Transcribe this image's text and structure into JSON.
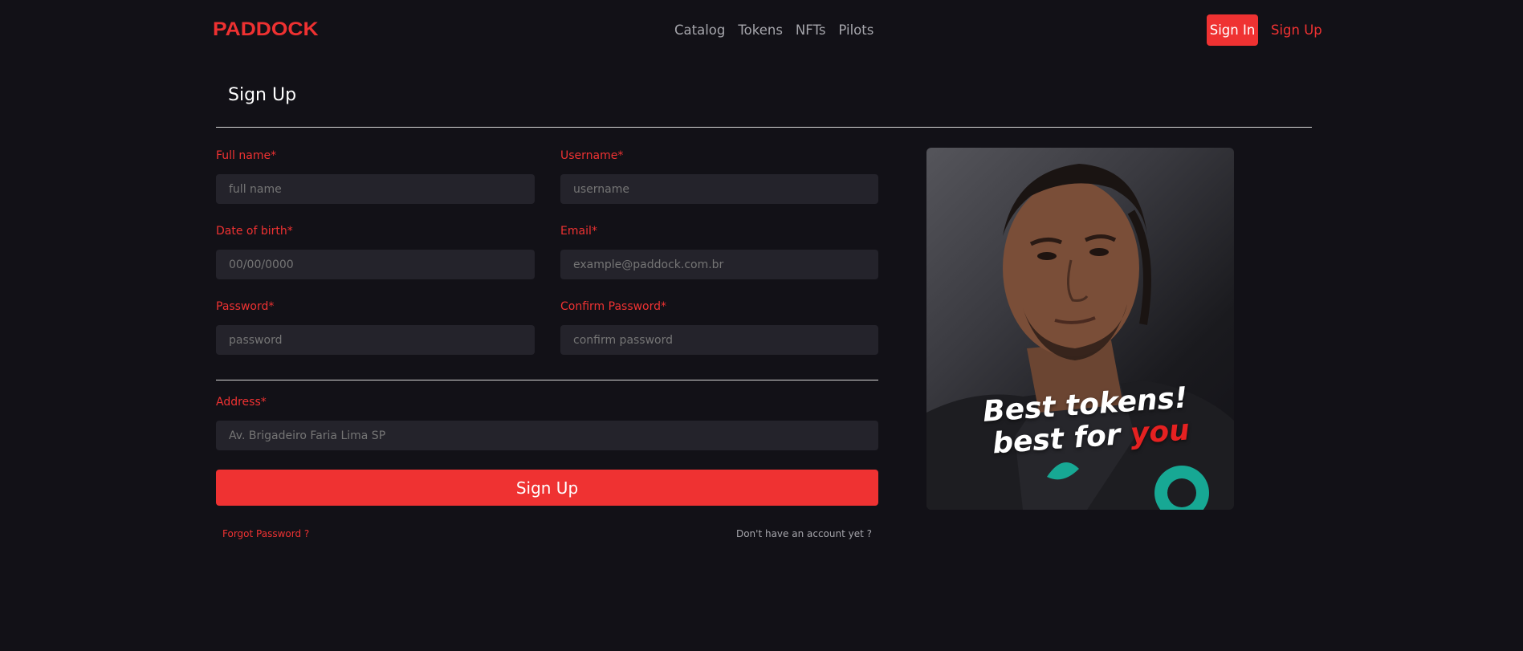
{
  "header": {
    "logo": "PADDOCK",
    "nav": [
      "Catalog",
      "Tokens",
      "NFTs",
      "Pilots"
    ],
    "sign_in": "Sign In",
    "sign_up": "Sign Up"
  },
  "page_title": "Sign Up",
  "form": {
    "full_name": {
      "label": "Full name*",
      "placeholder": "full name"
    },
    "username": {
      "label": "Username*",
      "placeholder": "username"
    },
    "dob": {
      "label": "Date of birth*",
      "placeholder": "00/00/0000"
    },
    "email": {
      "label": "Email*",
      "placeholder": "example@paddock.com.br"
    },
    "password": {
      "label": "Password*",
      "placeholder": "password"
    },
    "confirm_password": {
      "label": "Confirm Password*",
      "placeholder": "confirm password"
    },
    "address": {
      "label": "Address*",
      "placeholder": "Av. Brigadeiro Faria Lima SP"
    },
    "submit": "Sign Up",
    "forgot": "Forgot Password ?",
    "no_account": "Don't have an account yet ?"
  },
  "hero": {
    "line1": "Best tokens!",
    "line2_prefix": "best for ",
    "line2_accent": "you",
    "accent_color": "#e52121"
  },
  "colors": {
    "background": "#121117",
    "brand": "#ef3232",
    "input_bg": "#24232b"
  }
}
